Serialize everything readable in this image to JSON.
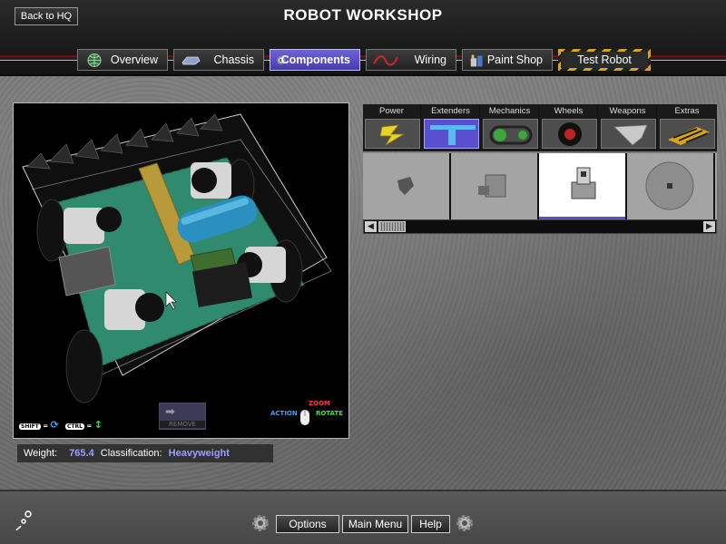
{
  "header": {
    "title": "ROBOT WORKSHOP",
    "back_label": "Back to HQ"
  },
  "tabs": [
    {
      "label": "Overview",
      "icon": "globe-icon"
    },
    {
      "label": "Chassis",
      "icon": "chassis-icon"
    },
    {
      "label": "Components",
      "icon": "gear-icon",
      "active": true
    },
    {
      "label": "Wiring",
      "icon": "wire-icon"
    },
    {
      "label": "Paint Shop",
      "icon": "paint-can-icon"
    },
    {
      "label": "Test Robot",
      "icon": ""
    }
  ],
  "viewport": {
    "shift_key": "SHIFT",
    "ctrl_key": "CTRL",
    "remove_label": "REMOVE",
    "legend": {
      "action": "ACTION",
      "zoom": "ZOOM",
      "rotate": "ROTATE"
    }
  },
  "status": {
    "weight_label": "Weight:",
    "weight_value": "765.4",
    "class_label": "Classification:",
    "class_value": "Heavyweight"
  },
  "categories": [
    {
      "label": "Power",
      "icon": "lightning-icon"
    },
    {
      "label": "Extenders",
      "icon": "extender-bar-icon",
      "selected": true
    },
    {
      "label": "Mechanics",
      "icon": "chain-sprocket-icon"
    },
    {
      "label": "Wheels",
      "icon": "wheel-icon"
    },
    {
      "label": "Weapons",
      "icon": "blade-icon"
    },
    {
      "label": "Extras",
      "icon": "hazard-plate-icon"
    }
  ],
  "bottom": {
    "options_label": "Options",
    "main_menu_label": "Main Menu",
    "help_label": "Help"
  },
  "colors": {
    "accent": "#5a4fcf",
    "value_text": "#9aa0ff",
    "zoom": "#ff3b3b",
    "rotate": "#2ee82e",
    "action": "#3aa0ff"
  }
}
